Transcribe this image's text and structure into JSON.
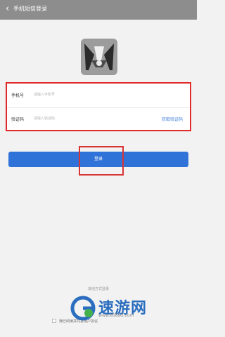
{
  "header": {
    "back_icon": "chevron-left-icon",
    "title": "手机短信登录"
  },
  "logo": {
    "icon": "app-logo-icon"
  },
  "form": {
    "phone_label": "手机号",
    "phone_placeholder": "请输入手机号",
    "code_label": "验证码",
    "code_placeholder": "请输入验证码",
    "get_code": "获取验证码"
  },
  "login": {
    "label": "登录"
  },
  "other": {
    "title": "其他方式登录"
  },
  "agreement": {
    "text": "我已阅读并同意用户协议"
  },
  "watermark": {
    "brand": "速游网",
    "url": "www.k688G.com"
  },
  "colors": {
    "accent": "#2f73d8",
    "highlight": "#e02a2a",
    "header": "#8d8d8d"
  }
}
